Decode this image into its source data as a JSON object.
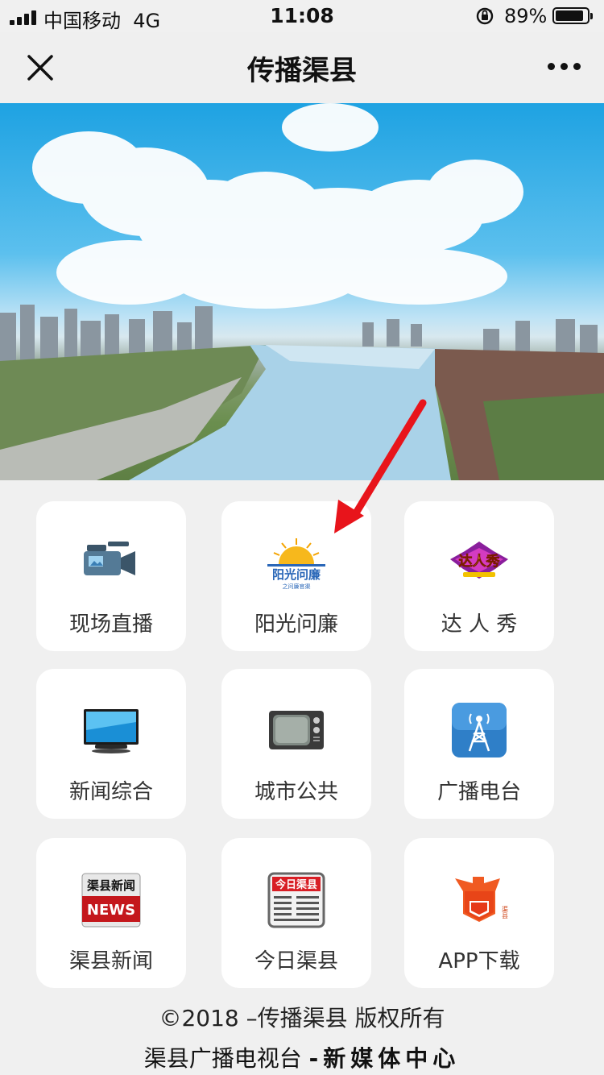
{
  "status_bar": {
    "carrier": "中国移动",
    "network": "4G",
    "time": "11:08",
    "battery_percent": "89%",
    "battery_level": 0.89
  },
  "nav": {
    "title": "传播渠县",
    "close_icon": "close-icon",
    "more_icon": "more-icon"
  },
  "tiles": [
    {
      "label": "现场直播",
      "icon": "video-camera-icon"
    },
    {
      "label": "阳光问廉",
      "icon": "sunshine-logo-icon",
      "logo_main": "阳光问廉",
      "logo_sub": "之问廉官渠"
    },
    {
      "label": "达 人 秀",
      "icon": "talent-show-logo-icon",
      "logo_main": "达人秀"
    },
    {
      "label": "新闻综合",
      "icon": "tv-monitor-icon"
    },
    {
      "label": "城市公共",
      "icon": "retro-tv-icon"
    },
    {
      "label": "广播电台",
      "icon": "radio-tower-icon"
    },
    {
      "label": "渠县新闻",
      "icon": "news-icon",
      "logo_main": "渠县新闻",
      "logo_sub": "NEWS"
    },
    {
      "label": "今日渠县",
      "icon": "newspaper-icon",
      "logo_main": "今日渠县"
    },
    {
      "label": "APP下载",
      "icon": "app-logo-icon",
      "logo_sub": "渠县"
    }
  ],
  "footer": {
    "copyright": "©2018 –传播渠县 版权所有",
    "org_prefix": "渠县广播电视台 ",
    "org_bold": "-新媒体中心"
  },
  "colors": {
    "background": "#f0f0f0",
    "card": "#ffffff",
    "arrow": "#e8141b",
    "sky": "#1ea2e2"
  }
}
